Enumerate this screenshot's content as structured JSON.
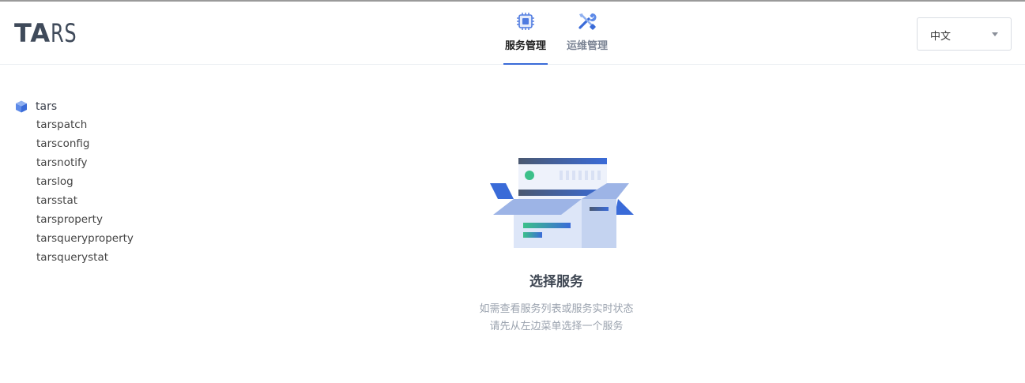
{
  "header": {
    "logo": {
      "bold": "TA",
      "light": "RS"
    },
    "nav": [
      {
        "label": "服务管理",
        "icon": "chip-icon",
        "active": true
      },
      {
        "label": "运维管理",
        "icon": "tools-icon",
        "active": false
      }
    ],
    "language": {
      "selected": "中文"
    }
  },
  "sidebar": {
    "root": {
      "label": "tars",
      "icon": "cube-icon"
    },
    "children": [
      "tarspatch",
      "tarsconfig",
      "tarsnotify",
      "tarslog",
      "tarsstat",
      "tarsproperty",
      "tarsqueryproperty",
      "tarsquerystat"
    ]
  },
  "empty_state": {
    "title": "选择服务",
    "line1": "如需查看服务列表或服务实时状态",
    "line2": "请先从左边菜单选择一个服务",
    "illustration": "open-box-illustration"
  },
  "colors": {
    "accent": "#3a6bd8",
    "green": "#3cc08a"
  }
}
